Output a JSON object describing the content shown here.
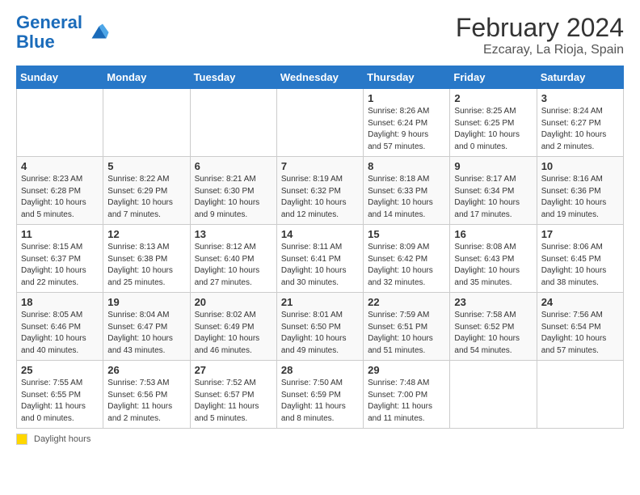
{
  "header": {
    "logo_line1": "General",
    "logo_line2": "Blue",
    "month_year": "February 2024",
    "location": "Ezcaray, La Rioja, Spain"
  },
  "days_of_week": [
    "Sunday",
    "Monday",
    "Tuesday",
    "Wednesday",
    "Thursday",
    "Friday",
    "Saturday"
  ],
  "weeks": [
    [
      {
        "day": "",
        "info": ""
      },
      {
        "day": "",
        "info": ""
      },
      {
        "day": "",
        "info": ""
      },
      {
        "day": "",
        "info": ""
      },
      {
        "day": "1",
        "info": "Sunrise: 8:26 AM\nSunset: 6:24 PM\nDaylight: 9 hours\nand 57 minutes."
      },
      {
        "day": "2",
        "info": "Sunrise: 8:25 AM\nSunset: 6:25 PM\nDaylight: 10 hours\nand 0 minutes."
      },
      {
        "day": "3",
        "info": "Sunrise: 8:24 AM\nSunset: 6:27 PM\nDaylight: 10 hours\nand 2 minutes."
      }
    ],
    [
      {
        "day": "4",
        "info": "Sunrise: 8:23 AM\nSunset: 6:28 PM\nDaylight: 10 hours\nand 5 minutes."
      },
      {
        "day": "5",
        "info": "Sunrise: 8:22 AM\nSunset: 6:29 PM\nDaylight: 10 hours\nand 7 minutes."
      },
      {
        "day": "6",
        "info": "Sunrise: 8:21 AM\nSunset: 6:30 PM\nDaylight: 10 hours\nand 9 minutes."
      },
      {
        "day": "7",
        "info": "Sunrise: 8:19 AM\nSunset: 6:32 PM\nDaylight: 10 hours\nand 12 minutes."
      },
      {
        "day": "8",
        "info": "Sunrise: 8:18 AM\nSunset: 6:33 PM\nDaylight: 10 hours\nand 14 minutes."
      },
      {
        "day": "9",
        "info": "Sunrise: 8:17 AM\nSunset: 6:34 PM\nDaylight: 10 hours\nand 17 minutes."
      },
      {
        "day": "10",
        "info": "Sunrise: 8:16 AM\nSunset: 6:36 PM\nDaylight: 10 hours\nand 19 minutes."
      }
    ],
    [
      {
        "day": "11",
        "info": "Sunrise: 8:15 AM\nSunset: 6:37 PM\nDaylight: 10 hours\nand 22 minutes."
      },
      {
        "day": "12",
        "info": "Sunrise: 8:13 AM\nSunset: 6:38 PM\nDaylight: 10 hours\nand 25 minutes."
      },
      {
        "day": "13",
        "info": "Sunrise: 8:12 AM\nSunset: 6:40 PM\nDaylight: 10 hours\nand 27 minutes."
      },
      {
        "day": "14",
        "info": "Sunrise: 8:11 AM\nSunset: 6:41 PM\nDaylight: 10 hours\nand 30 minutes."
      },
      {
        "day": "15",
        "info": "Sunrise: 8:09 AM\nSunset: 6:42 PM\nDaylight: 10 hours\nand 32 minutes."
      },
      {
        "day": "16",
        "info": "Sunrise: 8:08 AM\nSunset: 6:43 PM\nDaylight: 10 hours\nand 35 minutes."
      },
      {
        "day": "17",
        "info": "Sunrise: 8:06 AM\nSunset: 6:45 PM\nDaylight: 10 hours\nand 38 minutes."
      }
    ],
    [
      {
        "day": "18",
        "info": "Sunrise: 8:05 AM\nSunset: 6:46 PM\nDaylight: 10 hours\nand 40 minutes."
      },
      {
        "day": "19",
        "info": "Sunrise: 8:04 AM\nSunset: 6:47 PM\nDaylight: 10 hours\nand 43 minutes."
      },
      {
        "day": "20",
        "info": "Sunrise: 8:02 AM\nSunset: 6:49 PM\nDaylight: 10 hours\nand 46 minutes."
      },
      {
        "day": "21",
        "info": "Sunrise: 8:01 AM\nSunset: 6:50 PM\nDaylight: 10 hours\nand 49 minutes."
      },
      {
        "day": "22",
        "info": "Sunrise: 7:59 AM\nSunset: 6:51 PM\nDaylight: 10 hours\nand 51 minutes."
      },
      {
        "day": "23",
        "info": "Sunrise: 7:58 AM\nSunset: 6:52 PM\nDaylight: 10 hours\nand 54 minutes."
      },
      {
        "day": "24",
        "info": "Sunrise: 7:56 AM\nSunset: 6:54 PM\nDaylight: 10 hours\nand 57 minutes."
      }
    ],
    [
      {
        "day": "25",
        "info": "Sunrise: 7:55 AM\nSunset: 6:55 PM\nDaylight: 11 hours\nand 0 minutes."
      },
      {
        "day": "26",
        "info": "Sunrise: 7:53 AM\nSunset: 6:56 PM\nDaylight: 11 hours\nand 2 minutes."
      },
      {
        "day": "27",
        "info": "Sunrise: 7:52 AM\nSunset: 6:57 PM\nDaylight: 11 hours\nand 5 minutes."
      },
      {
        "day": "28",
        "info": "Sunrise: 7:50 AM\nSunset: 6:59 PM\nDaylight: 11 hours\nand 8 minutes."
      },
      {
        "day": "29",
        "info": "Sunrise: 7:48 AM\nSunset: 7:00 PM\nDaylight: 11 hours\nand 11 minutes."
      },
      {
        "day": "",
        "info": ""
      },
      {
        "day": "",
        "info": ""
      }
    ]
  ],
  "footer": {
    "legend_label": "Daylight hours"
  }
}
